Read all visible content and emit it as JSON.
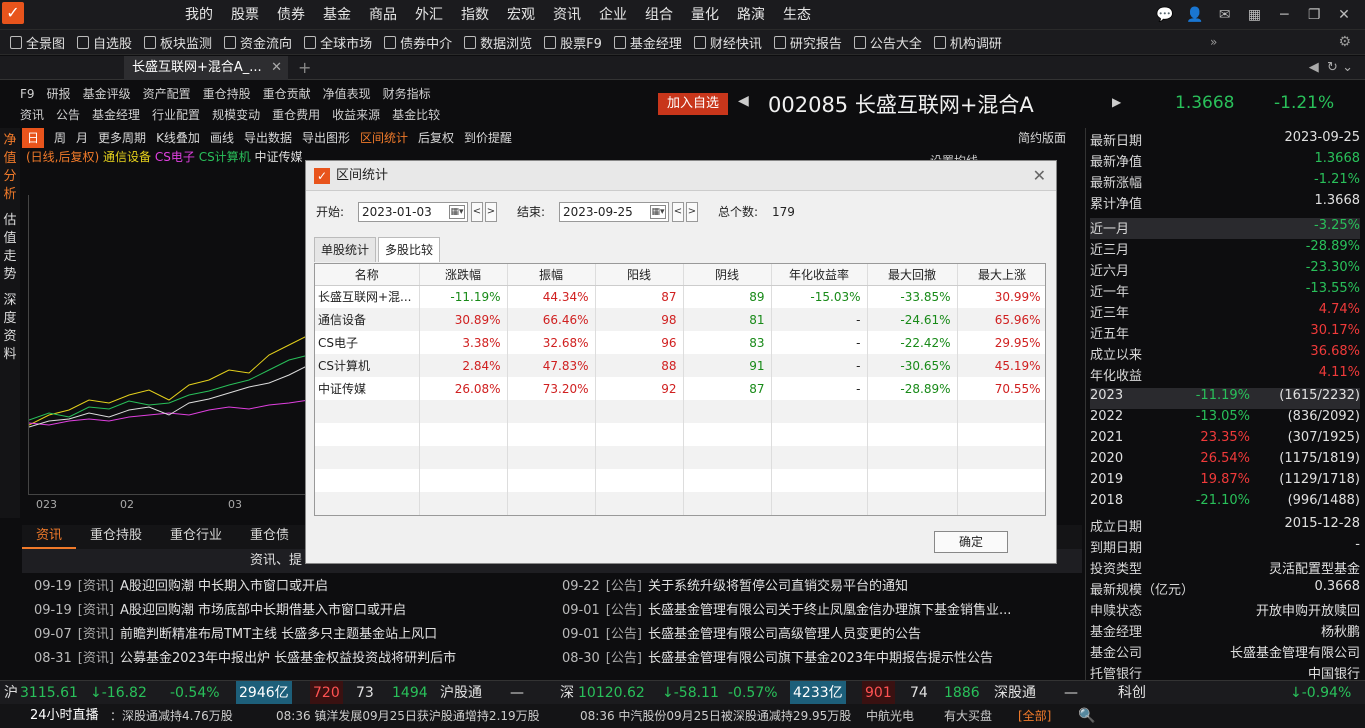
{
  "menubar": {
    "items": [
      "我的",
      "股票",
      "债券",
      "基金",
      "商品",
      "外汇",
      "指数",
      "宏观",
      "资讯",
      "企业",
      "组合",
      "量化",
      "路演",
      "生态"
    ]
  },
  "toolbar": {
    "items": [
      "全景图",
      "自选股",
      "板块监测",
      "资金流向",
      "全球市场",
      "债券中介",
      "数据浏览",
      "股票F9",
      "基金经理",
      "财经快讯",
      "研究报告",
      "公告大全",
      "机构调研"
    ]
  },
  "tabstrip": {
    "tab1": "长盛互联网+混合A_...",
    "plus": "+"
  },
  "f9": {
    "tag": "F9",
    "row1": [
      "研报",
      "基金评级",
      "资产配置",
      "重仓持股",
      "重仓贡献",
      "净值表现",
      "财务指标"
    ],
    "tag2": "资讯",
    "row2": [
      "公告",
      "基金经理",
      "行业配置",
      "规模变动",
      "重仓费用",
      "收益来源",
      "基金比较"
    ]
  },
  "header": {
    "add_btn": "加入自选",
    "title": "002085 长盛互联网+混合A",
    "nav": "1.3668",
    "change": "-1.21%"
  },
  "lefttabs": [
    "净值分析",
    "估值走势",
    "深度资料"
  ],
  "charttools": {
    "day": "日",
    "items": [
      "周",
      "月",
      "更多周期",
      "K线叠加",
      "画线",
      "导出数据",
      "导出图形"
    ],
    "active": "区间统计",
    "items2": [
      "后复权",
      "到价提醒"
    ],
    "simple": "简约版面"
  },
  "legend": {
    "mode": "(日线,后复权)",
    "s1": "通信设备",
    "s2": "CS电子",
    "s3": "CS计算机",
    "s4": "中证传媒",
    "extra": "设置均线"
  },
  "xaxis": [
    "023",
    "02",
    "03"
  ],
  "dialog": {
    "title": "区间统计",
    "start_label": "开始:",
    "start": "2023-01-03",
    "end_label": "结束:",
    "end": "2023-09-25",
    "count_label": "总个数:",
    "count": "179",
    "tabs": [
      "单股统计",
      "多股比较"
    ],
    "columns": [
      "名称",
      "涨跌幅",
      "振幅",
      "阳线",
      "阴线",
      "年化收益率",
      "最大回撤",
      "最大上涨"
    ],
    "rows": [
      [
        "长盛互联网+混...",
        "-11.19%",
        "44.34%",
        "87",
        "89",
        "-15.03%",
        "-33.85%",
        "30.99%"
      ],
      [
        "通信设备",
        "30.89%",
        "66.46%",
        "98",
        "81",
        "-",
        "-24.61%",
        "65.96%"
      ],
      [
        "CS电子",
        "3.38%",
        "32.68%",
        "96",
        "83",
        "-",
        "-22.42%",
        "29.95%"
      ],
      [
        "CS计算机",
        "2.84%",
        "47.83%",
        "88",
        "91",
        "-",
        "-30.65%",
        "45.19%"
      ],
      [
        "中证传媒",
        "26.08%",
        "73.20%",
        "92",
        "87",
        "-",
        "-28.89%",
        "70.55%"
      ]
    ],
    "ok": "确定"
  },
  "right": {
    "kv1": [
      [
        "最新日期",
        "2023-09-25"
      ],
      [
        "最新净值",
        "1.3668"
      ],
      [
        "最新涨幅",
        "-1.21%"
      ],
      [
        "累计净值",
        "1.3668"
      ]
    ],
    "periods": [
      [
        "近一月",
        "-3.25%"
      ],
      [
        "近三月",
        "-28.89%"
      ],
      [
        "近六月",
        "-23.30%"
      ],
      [
        "近一年",
        "-13.55%"
      ],
      [
        "近三年",
        "4.74%"
      ],
      [
        "近五年",
        "30.17%"
      ],
      [
        "成立以来",
        "36.68%"
      ],
      [
        "年化收益",
        "4.11%"
      ]
    ],
    "years": [
      [
        "2023",
        "-11.19%",
        "(1615/2232)"
      ],
      [
        "2022",
        "-13.05%",
        "(836/2092)"
      ],
      [
        "2021",
        "23.35%",
        "(307/1925)"
      ],
      [
        "2020",
        "26.54%",
        "(1175/1819)"
      ],
      [
        "2019",
        "19.87%",
        "(1129/1718)"
      ],
      [
        "2018",
        "-21.10%",
        "(996/1488)"
      ]
    ],
    "info": [
      [
        "成立日期",
        "2015-12-28"
      ],
      [
        "到期日期",
        "-"
      ],
      [
        "投资类型",
        "灵活配置型基金"
      ],
      [
        "最新规模（亿元）",
        "0.3668"
      ],
      [
        "申赎状态",
        "开放申购开放赎回"
      ],
      [
        "基金经理",
        "杨秋鹏"
      ],
      [
        "基金公司",
        "长盛基金管理有限公司"
      ],
      [
        "托管银行",
        "中国银行"
      ]
    ]
  },
  "newstabs": [
    "资讯",
    "重仓持股",
    "重仓行业",
    "重仓债"
  ],
  "newshead": "资讯、提",
  "news_left": [
    [
      "09-19",
      "[资讯]",
      "A股迎回购潮 中长期入市窗口或开启"
    ],
    [
      "09-19",
      "[资讯]",
      "A股迎回购潮 市场底部中长期借基入市窗口或开启"
    ],
    [
      "09-07",
      "[资讯]",
      "前瞻判断精准布局TMT主线 长盛多只主题基金站上风口"
    ],
    [
      "08-31",
      "[资讯]",
      "公募基金2023年中报出炉 长盛基金权益投资战将研判后市"
    ]
  ],
  "news_right": [
    [
      "09-22",
      "[公告]",
      "关于系统升级将暂停公司直销交易平台的通知"
    ],
    [
      "09-01",
      "[公告]",
      "长盛基金管理有限公司关于终止凤凰金信办理旗下基金销售业..."
    ],
    [
      "09-01",
      "[公告]",
      "长盛基金管理有限公司高级管理人员变更的公告"
    ],
    [
      "08-30",
      "[公告]",
      "长盛基金管理有限公司旗下基金2023年中期报告提示性公告"
    ]
  ],
  "status1": {
    "sh": "沪",
    "sh_idx": "3115.61",
    "sh_chg": "↓-16.82",
    "sh_pct": "-0.54%",
    "sh_amt": "2946亿",
    "sh_up": "720",
    "sh_eq": "73",
    "sh_dn": "1494",
    "sh_link": "沪股通",
    "sz": "深",
    "sz_idx": "10120.62",
    "sz_chg": "↓-58.11",
    "sz_pct": "-0.57%",
    "sz_amt": "4233亿",
    "sz_up": "901",
    "sz_eq": "74",
    "sz_dn": "1886",
    "sz_link": "深股通",
    "kc": "科创",
    "kc_pct": "↓-0.94%"
  },
  "status2": {
    "live": "24小时直播",
    "n1": "：深股通减持4.76万股",
    "n2": "08:36 镇洋发展09月25日获沪股通增持2.19万股",
    "n3": "08:36 中汽股份09月25日被深股通减持29.95万股",
    "n4": "中航光电",
    "n5": "有大买盘",
    "all": "[全部]"
  }
}
